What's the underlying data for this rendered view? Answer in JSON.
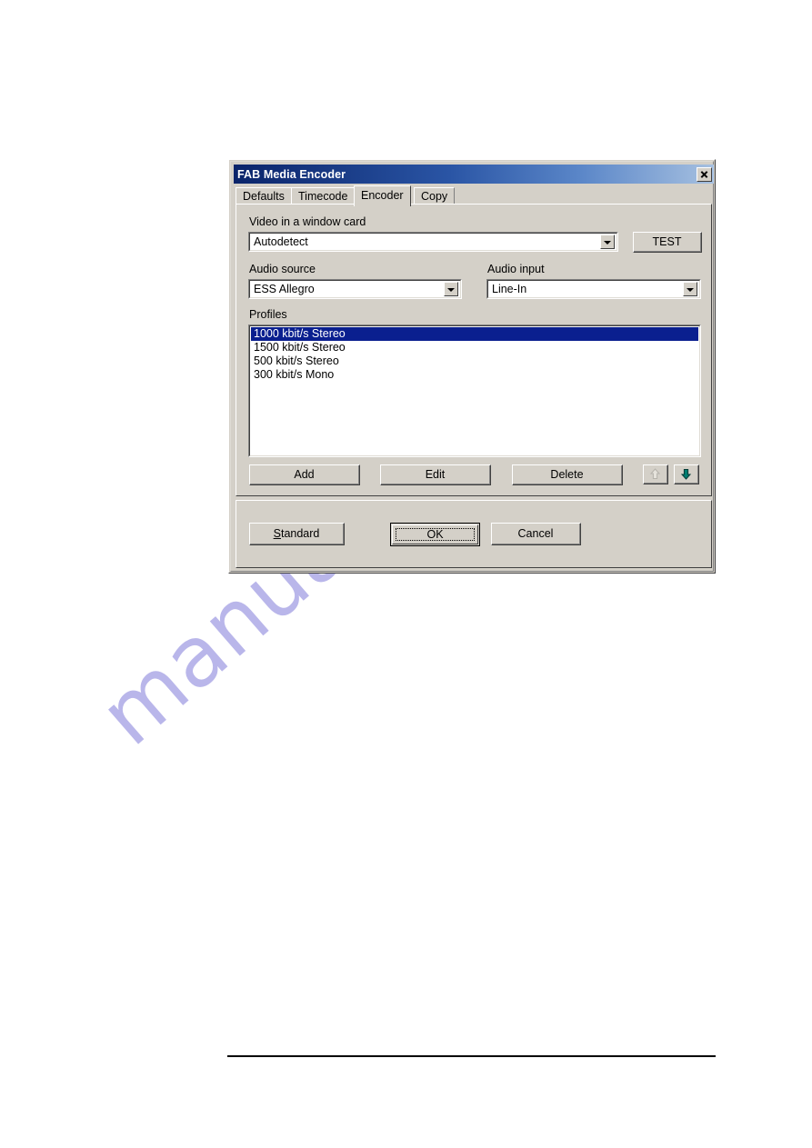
{
  "page": {
    "watermark_text": "manualshive.com",
    "watermark_color": "#b9b6ea",
    "background_color": "#ffffff",
    "rule_color": "#000000"
  },
  "dialog": {
    "title": "FAB Media Encoder",
    "titlebar_gradient_start": "#0a246a",
    "titlebar_gradient_end": "#a6c0e0",
    "face_color": "#d4d0c8",
    "close_icon": "close-icon",
    "tabs": [
      {
        "label": "Defaults",
        "selected": false
      },
      {
        "label": "Timecode",
        "selected": false
      },
      {
        "label": "Encoder",
        "selected": true
      },
      {
        "label": "Copy",
        "selected": false
      }
    ],
    "encoder_tab": {
      "video_card": {
        "label": "Video in a window card",
        "value": "Autodetect",
        "arrow_icon": "chevron-down-icon"
      },
      "test_button": {
        "label": "TEST"
      },
      "audio_source": {
        "label": "Audio source",
        "value": "ESS Allegro",
        "arrow_icon": "chevron-down-icon"
      },
      "audio_input": {
        "label": "Audio input",
        "value": "Line-In",
        "arrow_icon": "chevron-down-icon"
      },
      "profiles": {
        "label": "Profiles",
        "selection_color": "#0a1f8f",
        "items": [
          {
            "label": "1000 kbit/s Stereo",
            "selected": true
          },
          {
            "label": "1500 kbit/s Stereo",
            "selected": false
          },
          {
            "label": "500 kbit/s Stereo",
            "selected": false
          },
          {
            "label": "300 kbit/s Mono",
            "selected": false
          }
        ]
      },
      "list_buttons": {
        "add": "Add",
        "edit": "Edit",
        "delete": "Delete",
        "move_up_icon": "arrow-up-icon",
        "move_down_icon": "arrow-down-icon",
        "move_up_enabled": false,
        "move_down_enabled": true,
        "move_up_color": "#e6e3dc",
        "move_down_color": "#007d70"
      }
    },
    "footer": {
      "standard": {
        "label": "Standard",
        "accelerator": "S"
      },
      "ok": {
        "label": "OK",
        "is_default": true
      },
      "cancel": {
        "label": "Cancel"
      }
    }
  }
}
